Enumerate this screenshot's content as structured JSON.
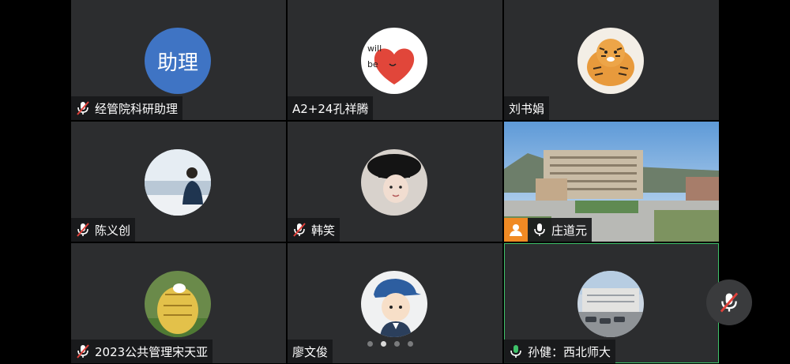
{
  "participants": [
    {
      "name": "经管院科研助理",
      "mic": "muted",
      "avatar_text": "助理",
      "avatar": "text-avatar"
    },
    {
      "name": "A2+24孔祥腾",
      "mic": "none",
      "avatar": "heart-drawing-avatar",
      "avatar_words": [
        "will",
        "be"
      ]
    },
    {
      "name": "刘书娟",
      "mic": "none",
      "avatar": "tiger-cartoon-avatar"
    },
    {
      "name": "陈义创",
      "mic": "muted",
      "avatar": "person-by-sea-avatar"
    },
    {
      "name": "韩笑",
      "mic": "muted",
      "avatar": "child-with-hat-avatar"
    },
    {
      "name": "庄道元",
      "mic": "on",
      "avatar": "campus-building-video"
    },
    {
      "name": "2023公共管理宋天亚",
      "mic": "muted",
      "avatar": "yellow-animal-avatar"
    },
    {
      "name": "廖文俊",
      "mic": "none",
      "avatar": "boy-cap-cartoon-avatar"
    },
    {
      "name": "孙健：西北师大",
      "mic": "speaking",
      "avatar": "building-photo-avatar",
      "active": true
    }
  ],
  "pagination": {
    "total": 4,
    "current": 2
  },
  "colors": {
    "tile_bg": "#2c2d2f",
    "active_border": "#3fc26a",
    "avatar_blue": "#3f74c4",
    "mute_red": "#e0413b",
    "badge_orange": "#f08a24"
  }
}
